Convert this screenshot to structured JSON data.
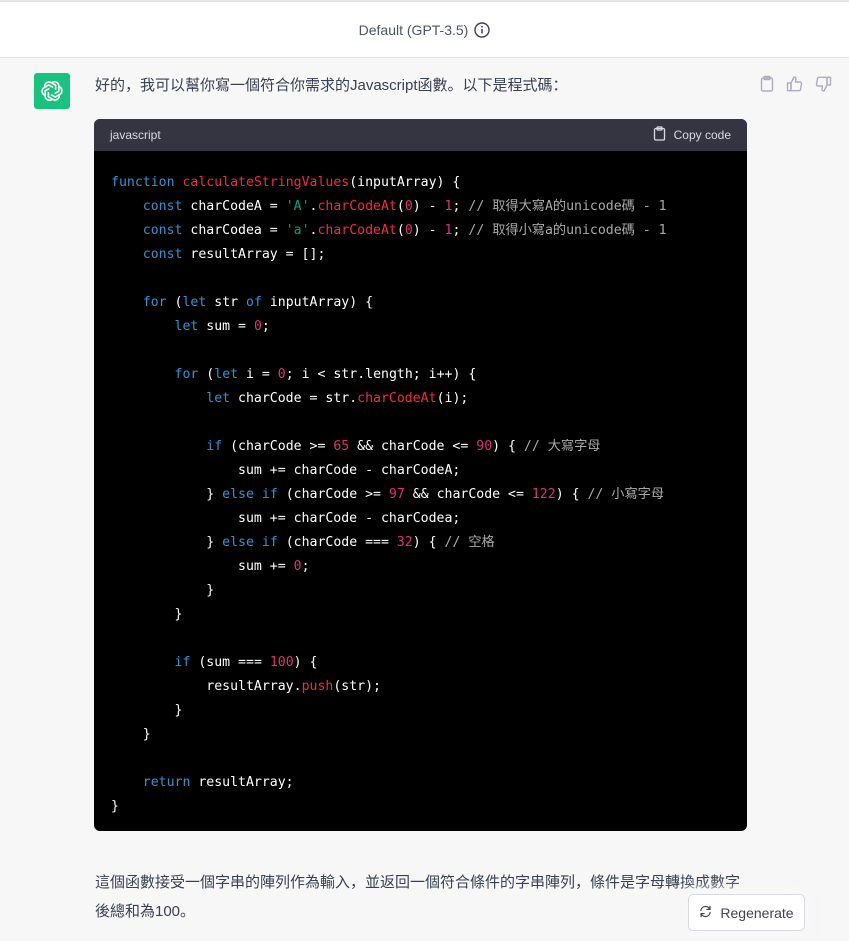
{
  "header": {
    "model_label": "Default (GPT-3.5)",
    "info_icon": "info-circle-icon"
  },
  "message": {
    "avatar_icon": "openai-logo-icon",
    "intro_text": "好的，我可以幫你寫一個符合你需求的Javascript函數。以下是程式碼：",
    "actions": [
      "clipboard-icon",
      "thumbs-up-icon",
      "thumbs-down-icon"
    ],
    "outro_text": "這個函數接受一個字串的陣列作為輸入，並返回一個符合條件的字串陣列，條件是字母轉換成數字後總和為100。"
  },
  "code_block": {
    "language": "javascript",
    "copy_label": "Copy code",
    "code": "function calculateStringValues(inputArray) {\n    const charCodeA = 'A'.charCodeAt(0) - 1; // 取得大寫A的unicode碼 - 1\n    const charCodea = 'a'.charCodeAt(0) - 1; // 取得小寫a的unicode碼 - 1\n    const resultArray = [];\n\n    for (let str of inputArray) {\n        let sum = 0;\n\n        for (let i = 0; i < str.length; i++) {\n            let charCode = str.charCodeAt(i);\n\n            if (charCode >= 65 && charCode <= 90) { // 大寫字母\n                sum += charCode - charCodeA;\n            } else if (charCode >= 97 && charCode <= 122) { // 小寫字母\n                sum += charCode - charCodea;\n            } else if (charCode === 32) { // 空格\n                sum += 0;\n            }\n        }\n\n        if (sum === 100) {\n            resultArray.push(str);\n        }\n    }\n\n    return resultArray;\n}"
  },
  "regenerate": {
    "label": "Regenerate",
    "icon": "refresh-icon"
  },
  "colors": {
    "avatar_bg": "#19c37d",
    "code_bg": "#000000",
    "code_header_bg": "#343541"
  }
}
